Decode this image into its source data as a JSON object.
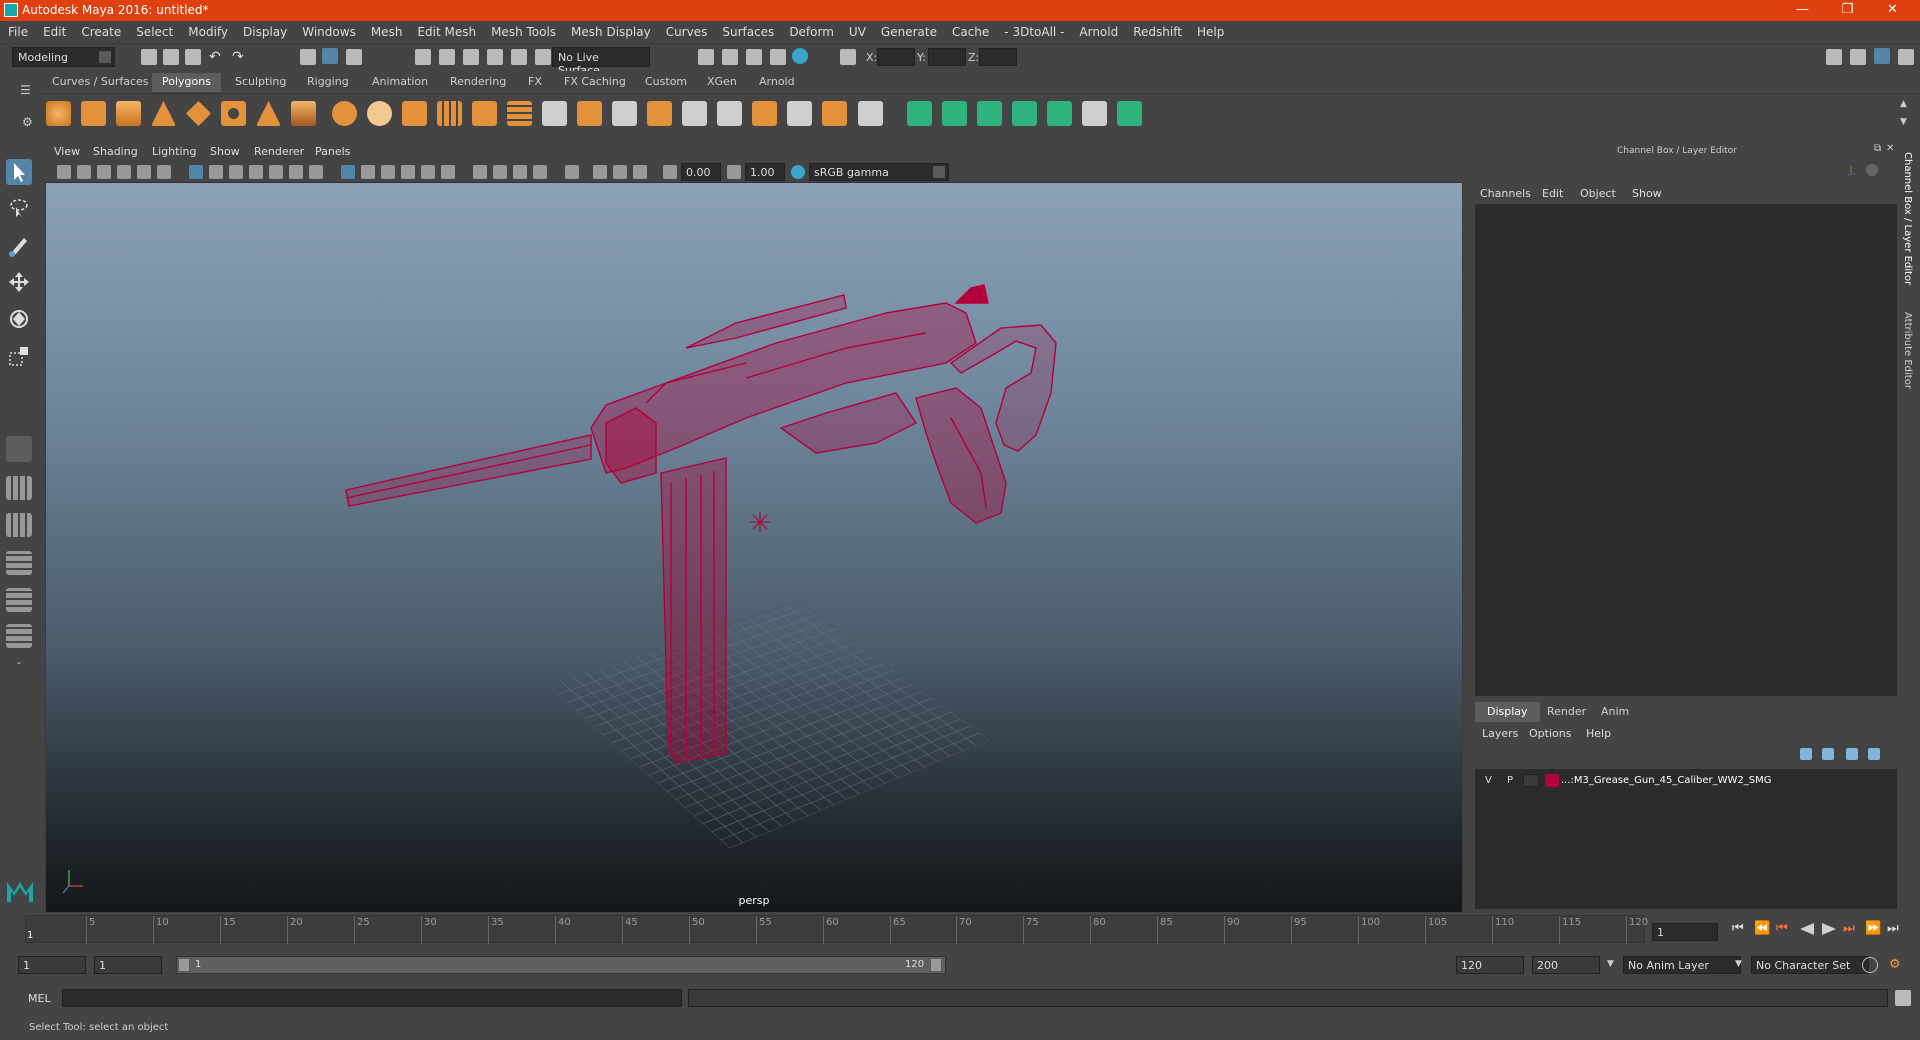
{
  "window": {
    "title": "Autodesk Maya 2016: untitled*",
    "minimize_icon": "minimize-icon",
    "restore_icon": "restore-icon",
    "close_icon": "close-icon"
  },
  "menubar": [
    "File",
    "Edit",
    "Create",
    "Select",
    "Modify",
    "Display",
    "Windows",
    "Mesh",
    "Edit Mesh",
    "Mesh Tools",
    "Mesh Display",
    "Curves",
    "Surfaces",
    "Deform",
    "UV",
    "Generate",
    "Cache",
    "- 3DtoAll -",
    "Arnold",
    "Redshift",
    "Help"
  ],
  "statusline": {
    "mode": "Modeling",
    "live_surface": "No Live Surface",
    "x_label": "X:",
    "y_label": "Y:",
    "z_label": "Z:"
  },
  "shelf_tabs": [
    "Curves / Surfaces",
    "Polygons",
    "Sculpting",
    "Rigging",
    "Animation",
    "Rendering",
    "FX",
    "FX Caching",
    "Custom",
    "XGen",
    "Arnold"
  ],
  "shelf_active": "Polygons",
  "viewport": {
    "menus": [
      "View",
      "Shading",
      "Lighting",
      "Show",
      "Renderer",
      "Panels"
    ],
    "exposure": "0.00",
    "gamma": "1.00",
    "color_space": "sRGB gamma",
    "camera_label": "persp",
    "wireframe_color": "#b4003a"
  },
  "channel_box": {
    "title": "Channel Box / Layer Editor",
    "menus": [
      "Channels",
      "Edit",
      "Object",
      "Show"
    ]
  },
  "layer_editor": {
    "tabs": [
      "Display",
      "Render",
      "Anim"
    ],
    "active_tab": "Display",
    "menus": [
      "Layers",
      "Options",
      "Help"
    ],
    "layers": [
      {
        "visible": "V",
        "playback": "P",
        "color": "#b4003a",
        "name": "...:M3_Grease_Gun_45_Caliber_WW2_SMG"
      }
    ]
  },
  "side_tabs": [
    "Channel Box / Layer Editor",
    "Attribute Editor"
  ],
  "time_slider": {
    "ticks": [
      "5",
      "10",
      "15",
      "20",
      "25",
      "30",
      "35",
      "40",
      "45",
      "50",
      "55",
      "60",
      "65",
      "70",
      "75",
      "80",
      "85",
      "90",
      "95",
      "100",
      "105",
      "110",
      "115",
      "120"
    ],
    "start_label": "1",
    "current_frame": "1"
  },
  "range_slider": {
    "start": "1",
    "anim_start": "1",
    "range_start": "1",
    "range_end": "120",
    "end": "120",
    "anim_end": "200",
    "anim_layer": "No Anim Layer",
    "character_set": "No Character Set"
  },
  "command_line": {
    "label": "MEL"
  },
  "help_line": "Select Tool: select an object",
  "colors": {
    "title_bar": "#e0400f",
    "panel_bg": "#444444",
    "field_bg": "#2b2b2b",
    "selected_tool": "#5285a6"
  }
}
